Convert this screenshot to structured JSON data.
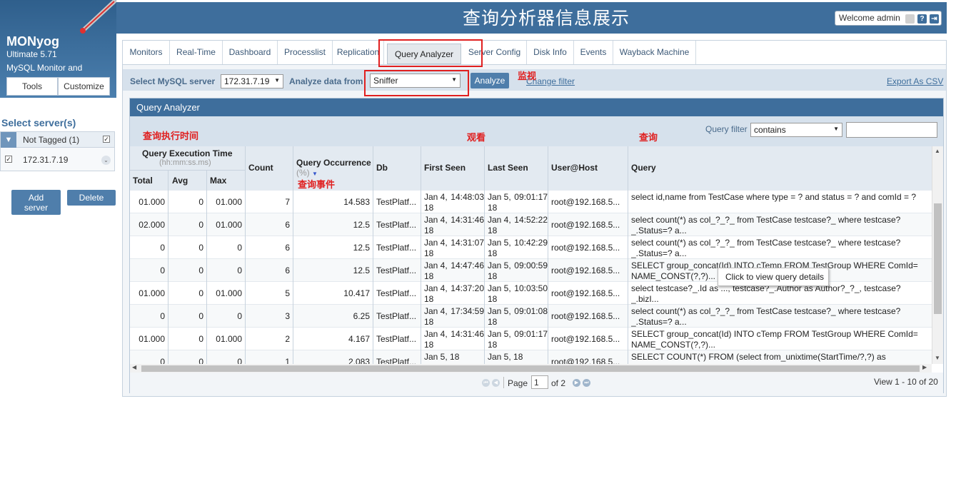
{
  "page_title": "查询分析器信息展示",
  "welcome": {
    "text": "Welcome admin"
  },
  "brand": {
    "name": "MONyog",
    "version": "Ultimate 5.71",
    "tagline": "MySQL Monitor and Advisor"
  },
  "brand_buttons": {
    "tools": "Tools",
    "customize": "Customize"
  },
  "sidebar": {
    "title": "Select server(s)",
    "group": {
      "label": "Not Tagged (1)",
      "checked": true
    },
    "server": {
      "label": "172.31.7.19",
      "checked": true
    },
    "add_button": "Add server",
    "delete_button": "Delete"
  },
  "tabs": [
    "Monitors",
    "Real-Time",
    "Dashboard",
    "Processlist",
    "Replication",
    "Query Analyzer",
    "Server Config",
    "Disk Info",
    "Events",
    "Wayback Machine"
  ],
  "active_tab": "Query Analyzer",
  "filterbar": {
    "server_label": "Select MySQL server",
    "server_value": "172.31.7.19",
    "analyze_label": "Analyze data from",
    "source_value": "Sniffer",
    "analyze_button": "Analyze",
    "change_filter": "Change filter",
    "export": "Export As CSV"
  },
  "panel": {
    "title": "Query Analyzer",
    "query_filter_label": "Query filter",
    "query_filter_mode": "contains",
    "query_filter_value": ""
  },
  "table": {
    "headers": {
      "exec_time": "Query Execution Time",
      "exec_time_unit": "(hh:mm:ss.ms)",
      "total": "Total",
      "avg": "Avg",
      "max": "Max",
      "count": "Count",
      "occurrence": "Query Occurrence",
      "occurrence_unit": "(%)",
      "db": "Db",
      "first_seen": "First Seen",
      "last_seen": "Last Seen",
      "user_host": "User@Host",
      "query": "Query"
    },
    "rows": [
      {
        "total": "01.000",
        "avg": "0",
        "max": "01.000",
        "count": "7",
        "occ": "14.583",
        "db": "TestPlatf...",
        "first_d": "Jan 4, 18",
        "first_t": "14:48:03",
        "last_d": "Jan 5, 18",
        "last_t": "09:01:17",
        "user": "root@192.168.5...",
        "query": "select id,name from TestCase where type = ? and status = ? and comId = ?"
      },
      {
        "total": "02.000",
        "avg": "0",
        "max": "01.000",
        "count": "6",
        "occ": "12.5",
        "db": "TestPlatf...",
        "first_d": "Jan 4, 18",
        "first_t": "14:31:46",
        "last_d": "Jan 4, 18",
        "last_t": "14:52:22",
        "user": "root@192.168.5...",
        "query": "select count(*) as col_?_?_ from TestCase testcase?_ where testcase?_.Status=? a..."
      },
      {
        "total": "0",
        "avg": "0",
        "max": "0",
        "count": "6",
        "occ": "12.5",
        "db": "TestPlatf...",
        "first_d": "Jan 4, 18",
        "first_t": "14:31:07",
        "last_d": "Jan 5, 18",
        "last_t": "10:42:29",
        "user": "root@192.168.5...",
        "query": "select count(*) as col_?_?_ from TestCase testcase?_ where testcase?_.Status=? a..."
      },
      {
        "total": "0",
        "avg": "0",
        "max": "0",
        "count": "6",
        "occ": "12.5",
        "db": "TestPlatf...",
        "first_d": "Jan 4, 18",
        "first_t": "14:47:46",
        "last_d": "Jan 5, 18",
        "last_t": "09:00:59",
        "user": "root@192.168.5...",
        "query": "SELECT group_concat(Id) INTO cTemp FROM TestGroup WHERE ComId= NAME_CONST(?,?)..."
      },
      {
        "total": "01.000",
        "avg": "0",
        "max": "01.000",
        "count": "5",
        "occ": "10.417",
        "db": "TestPlatf...",
        "first_d": "Jan 4, 18",
        "first_t": "14:37:20",
        "last_d": "Jan 5, 18",
        "last_t": "10:03:50",
        "user": "root@192.168.5...",
        "query": "select testcase?_.Id as ..., testcase?_.Author as Author?_?_, testcase?_.bizI..."
      },
      {
        "total": "0",
        "avg": "0",
        "max": "0",
        "count": "3",
        "occ": "6.25",
        "db": "TestPlatf...",
        "first_d": "Jan 4, 18",
        "first_t": "17:34:59",
        "last_d": "Jan 5, 18",
        "last_t": "09:01:08",
        "user": "root@192.168.5...",
        "query": "select count(*) as col_?_?_ from TestCase testcase?_ where testcase?_.Status=? a..."
      },
      {
        "total": "01.000",
        "avg": "0",
        "max": "01.000",
        "count": "2",
        "occ": "4.167",
        "db": "TestPlatf...",
        "first_d": "Jan 4, 18",
        "first_t": "14:31:46",
        "last_d": "Jan 5, 18",
        "last_t": "09:01:17",
        "user": "root@192.168.5...",
        "query": "SELECT group_concat(Id) INTO cTemp FROM TestGroup WHERE ComId= NAME_CONST(?,?)..."
      },
      {
        "total": "0",
        "avg": "0",
        "max": "0",
        "count": "1",
        "occ": "2.083",
        "db": "TestPlatf...",
        "first_d": "Jan 5, 18",
        "first_t": "",
        "last_d": "Jan 5, 18",
        "last_t": "",
        "user": "root@192.168.5...",
        "query": "SELECT COUNT(*) FROM (select from_unixtime(StartTime/?,?) as"
      }
    ]
  },
  "pager": {
    "page_label": "Page",
    "page_value": "1",
    "of_label": "of 2",
    "view_info": "View 1 - 10 of 20"
  },
  "tooltip": "Click to view query details",
  "annotations": {
    "exec_time": "查询执行时间",
    "monitor": "监视",
    "watch": "观看",
    "query": "查询",
    "occurrence": "查询事件"
  },
  "colors": {
    "primary": "#3e6e9c",
    "annotation": "#e02020",
    "button": "#4f7eab"
  }
}
